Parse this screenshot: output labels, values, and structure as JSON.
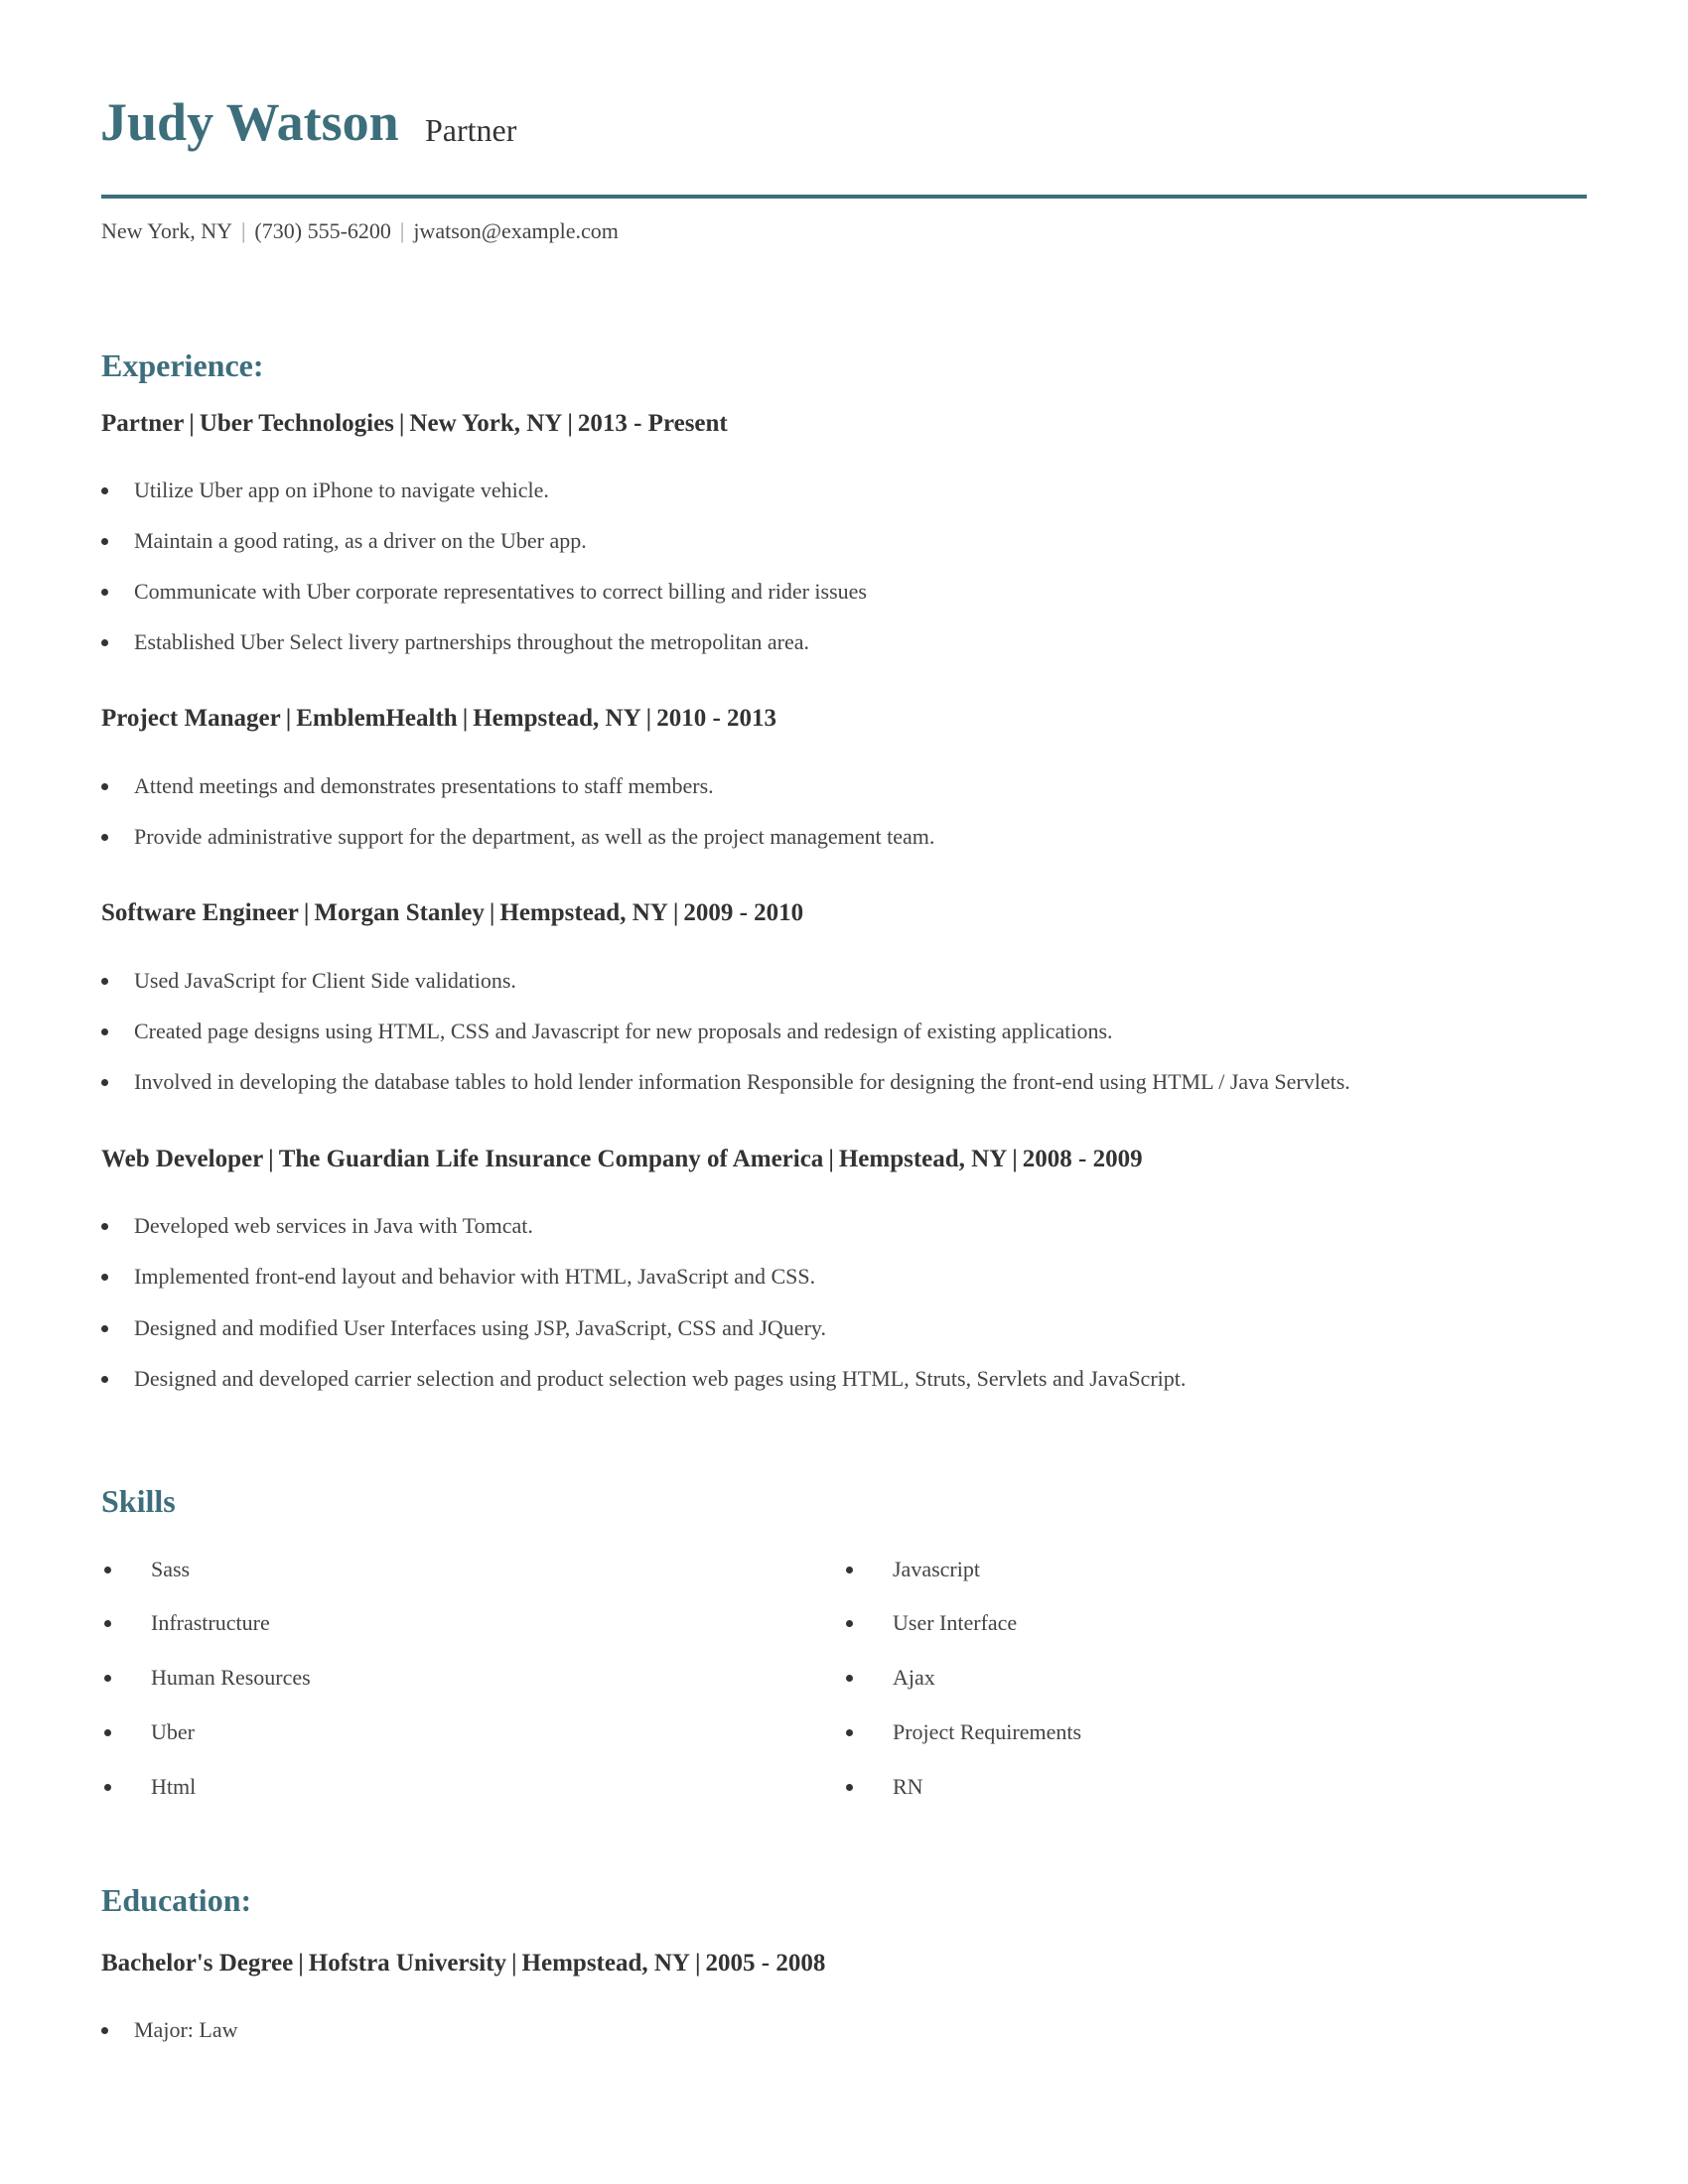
{
  "header": {
    "name": "Judy Watson",
    "title": "Partner",
    "contact": {
      "location": "New York, NY",
      "phone": "(730) 555-6200",
      "email": "jwatson@example.com",
      "separator": "|"
    },
    "accent_color": "#3d6e7c"
  },
  "experience": {
    "heading": "Experience:",
    "jobs": [
      {
        "title": "Partner",
        "company": "Uber Technologies",
        "location": "New York, NY",
        "dates": "2013 - Present",
        "bullets": [
          "Utilize Uber app on iPhone to navigate vehicle.",
          "Maintain a good rating, as a driver on the Uber app.",
          "Communicate with Uber corporate representatives to correct billing and rider issues",
          "Established Uber Select livery partnerships throughout the metropolitan area."
        ]
      },
      {
        "title": "Project Manager",
        "company": "EmblemHealth",
        "location": "Hempstead, NY",
        "dates": "2010 - 2013",
        "bullets": [
          "Attend meetings and demonstrates presentations to staff members.",
          "Provide administrative support for the department, as well as the project management team."
        ]
      },
      {
        "title": "Software Engineer",
        "company": "Morgan Stanley",
        "location": "Hempstead, NY",
        "dates": "2009 - 2010",
        "bullets": [
          "Used JavaScript for Client Side validations.",
          "Created page designs using HTML, CSS and Javascript for new proposals and redesign of existing applications.",
          "Involved in developing the database tables to hold lender information Responsible for designing the front-end using HTML / Java Servlets."
        ]
      },
      {
        "title": "Web Developer",
        "company": "The Guardian Life Insurance Company of America",
        "location": "Hempstead, NY",
        "dates": "2008 - 2009",
        "bullets": [
          "Developed web services in Java with Tomcat.",
          "Implemented front-end layout and behavior with HTML, JavaScript and CSS.",
          "Designed and modified User Interfaces using JSP, JavaScript, CSS and JQuery.",
          "Designed and developed carrier selection and product selection web pages using HTML, Struts, Servlets and JavaScript."
        ]
      }
    ]
  },
  "skills": {
    "heading": "Skills",
    "left": [
      "Sass",
      "Infrastructure",
      "Human Resources",
      "Uber",
      "Html"
    ],
    "right": [
      "Javascript",
      "User Interface",
      "Ajax",
      "Project Requirements",
      "RN"
    ]
  },
  "education": {
    "heading": "Education:",
    "entries": [
      {
        "degree": "Bachelor's Degree",
        "school": "Hofstra University",
        "location": "Hempstead, NY",
        "dates": "2005 - 2008",
        "bullets": [
          "Major: Law"
        ]
      }
    ]
  }
}
